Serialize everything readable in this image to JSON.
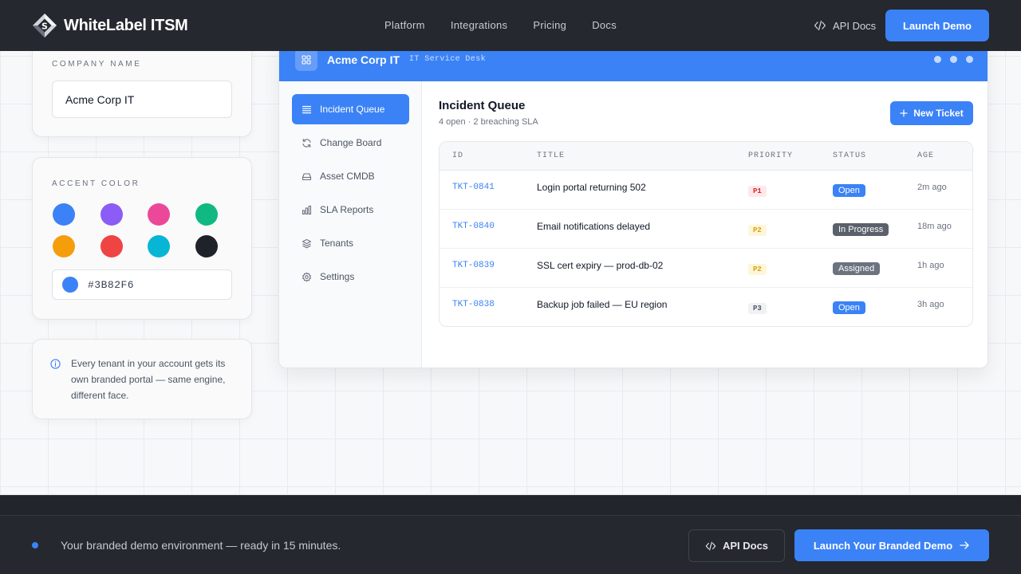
{
  "navbar": {
    "brand": "WhiteLabel ITSM",
    "logo_icon": "diamond-logo-icon",
    "links": [
      "Platform",
      "Integrations",
      "Pricing",
      "Docs"
    ],
    "api_docs": "API Docs",
    "launch": "Launch Demo"
  },
  "company_card": {
    "label": "COMPANY NAME",
    "value": "Acme Corp IT"
  },
  "accent_card": {
    "label": "ACCENT COLOR",
    "swatches": [
      "#3B82F6",
      "#8B5CF6",
      "#EC4899",
      "#10B981",
      "#F59E0B",
      "#EF4444",
      "#06B6D4",
      "#1F2329"
    ],
    "selected_hex": "#3B82F6"
  },
  "info_card": {
    "icon": "info-icon",
    "text": "Every tenant in your account gets its own branded portal — same engine, different face."
  },
  "window": {
    "title": "Acme Corp IT",
    "subtitle": "IT Service Desk",
    "accent": "#3B82F6",
    "sidebar": [
      {
        "label": "Incident Queue",
        "icon": "list-icon",
        "active": true
      },
      {
        "label": "Change Board",
        "icon": "refresh-icon",
        "active": false
      },
      {
        "label": "Asset CMDB",
        "icon": "drive-icon",
        "active": false
      },
      {
        "label": "SLA Reports",
        "icon": "bar-chart-icon",
        "active": false
      },
      {
        "label": "Tenants",
        "icon": "layers-icon",
        "active": false
      },
      {
        "label": "Settings",
        "icon": "gear-icon",
        "active": false
      }
    ],
    "main": {
      "title": "Incident Queue",
      "subtitle": "4 open · 2 breaching SLA",
      "new_ticket": "New Ticket"
    },
    "table": {
      "headers": [
        "ID",
        "TITLE",
        "PRIORITY",
        "STATUS",
        "AGE"
      ],
      "rows": [
        {
          "id": "TKT-0841",
          "title": "Login portal returning 502",
          "priority": "P1",
          "status": "Open",
          "age": "2m ago"
        },
        {
          "id": "TKT-0840",
          "title": "Email notifications delayed",
          "priority": "P2",
          "status": "In Progress",
          "age": "18m ago"
        },
        {
          "id": "TKT-0839",
          "title": "SSL cert expiry — prod-db-02",
          "priority": "P2",
          "status": "Assigned",
          "age": "1h ago"
        },
        {
          "id": "TKT-0838",
          "title": "Backup job failed — EU region",
          "priority": "P3",
          "status": "Open",
          "age": "3h ago"
        }
      ]
    }
  },
  "colors": {
    "priority": {
      "P1": {
        "bg": "#FDE8EA",
        "fg": "#DC2626"
      },
      "P2": {
        "bg": "#FEF6D8",
        "fg": "#D69E0B"
      },
      "P3": {
        "bg": "#F0F1F3",
        "fg": "#4B5563"
      }
    },
    "status": {
      "Open": "#3B82F6",
      "In Progress": "#5B616B",
      "Assigned": "#6B7280"
    }
  },
  "bottom_bar": {
    "text": "Your branded demo environment — ready in 15 minutes.",
    "api_docs": "API Docs",
    "launch": "Launch Your Branded Demo"
  }
}
